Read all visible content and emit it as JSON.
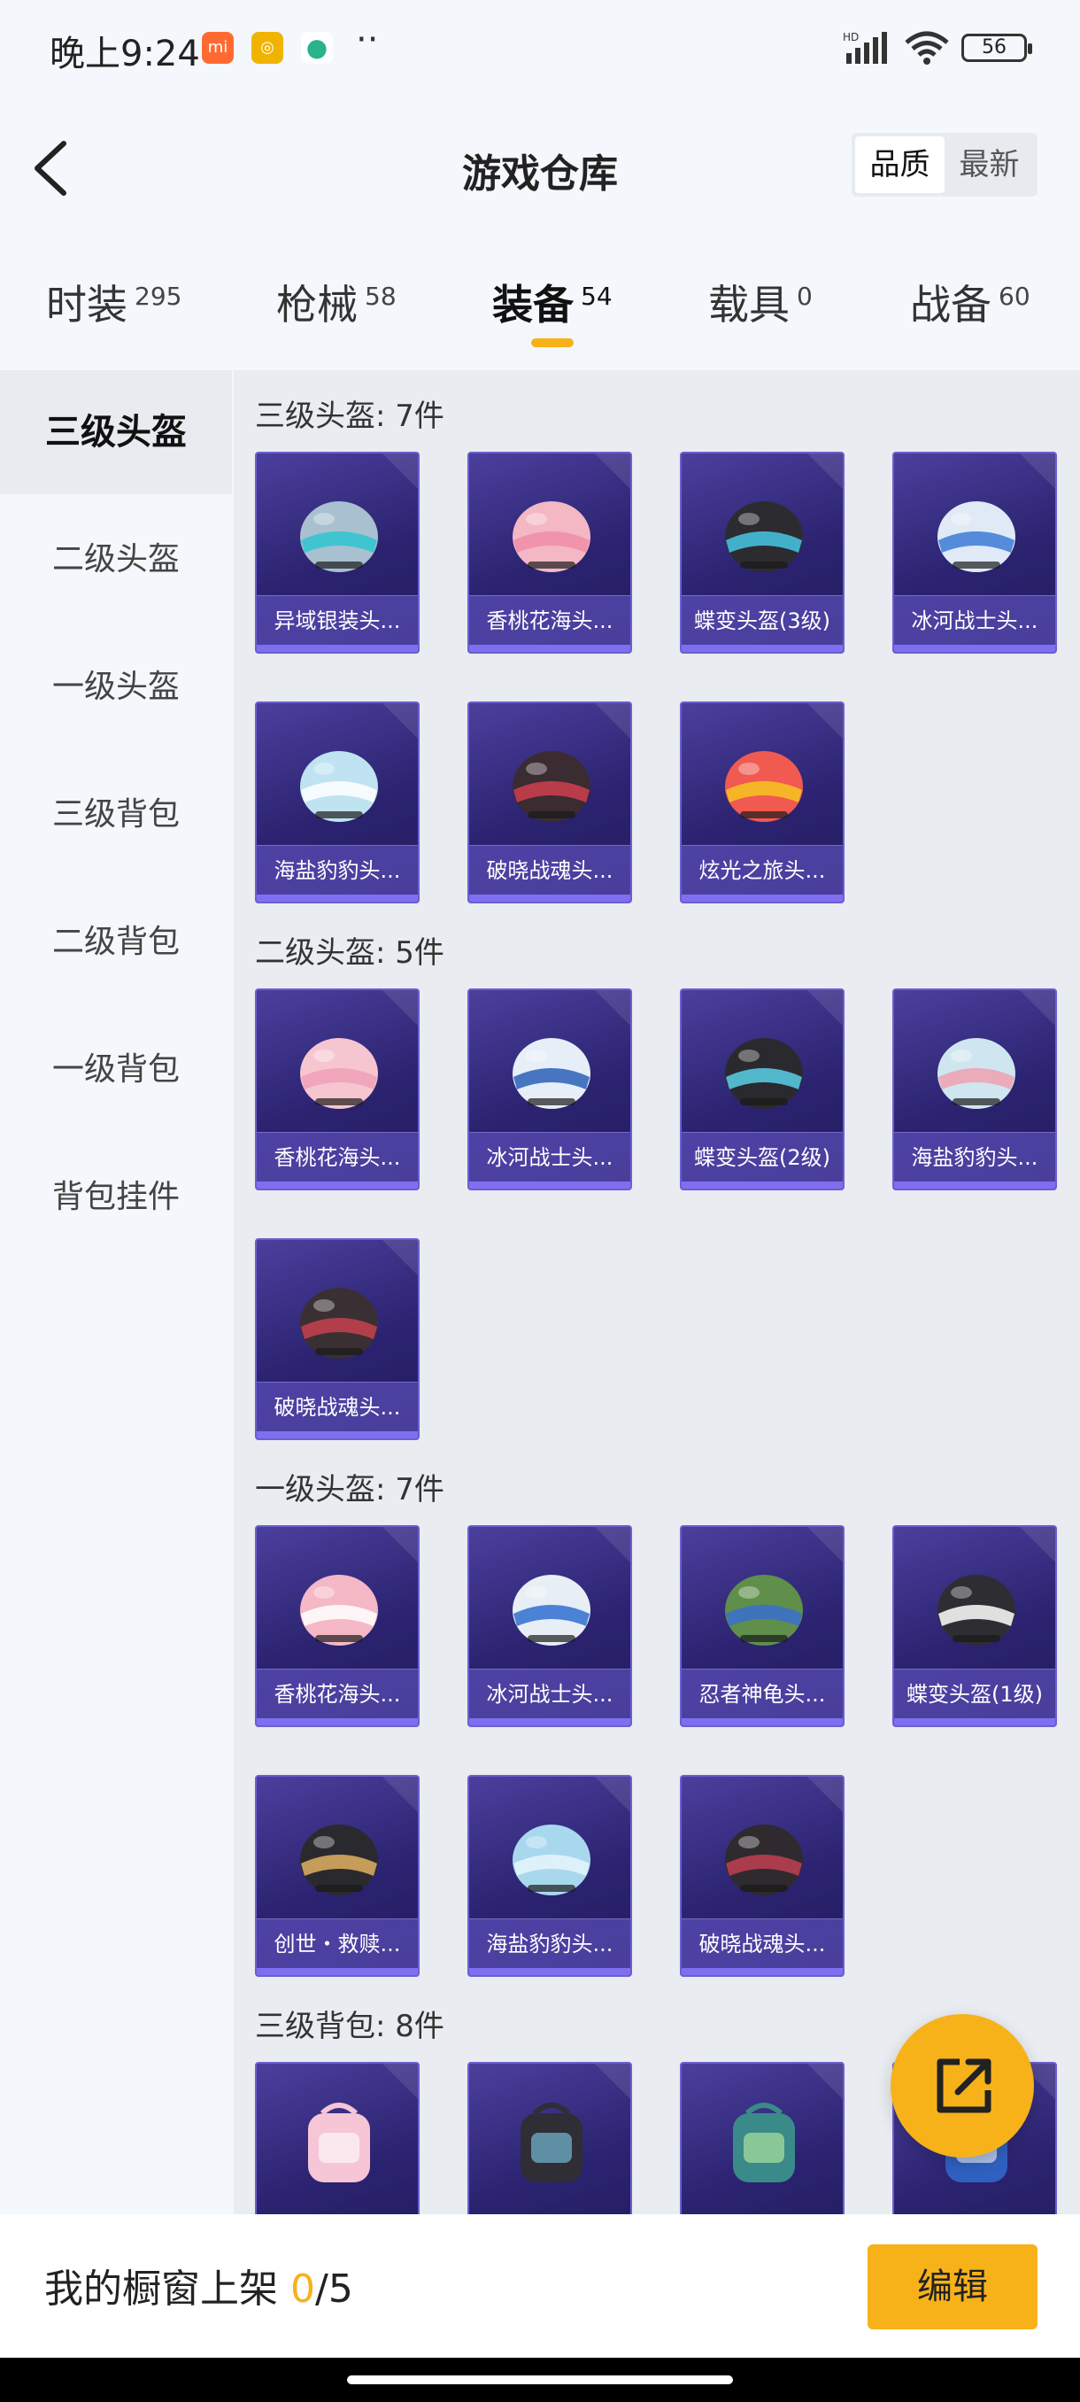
{
  "status": {
    "time": "晚上9:24",
    "apps": [
      {
        "name": "mi-app-icon",
        "color": "#ff6a33",
        "glyph": "mi"
      },
      {
        "name": "gear-app-icon",
        "color": "#f0b400",
        "glyph": "◎"
      },
      {
        "name": "leaf-app-icon",
        "color": "#28b38a",
        "glyph": "●"
      }
    ],
    "dots": "··",
    "hd": "HD",
    "battery": "56"
  },
  "header": {
    "title": "游戏仓库",
    "sort_options": [
      "品质",
      "最新"
    ],
    "sort_active": 0
  },
  "tabs": [
    {
      "label": "时装",
      "count": "295"
    },
    {
      "label": "枪械",
      "count": "58"
    },
    {
      "label": "装备",
      "count": "54",
      "active": true
    },
    {
      "label": "载具",
      "count": "0"
    },
    {
      "label": "战备",
      "count": "60"
    }
  ],
  "sidebar": {
    "items": [
      "三级头盔",
      "二级头盔",
      "一级头盔",
      "三级背包",
      "二级背包",
      "一级背包",
      "背包挂件"
    ],
    "active": 0
  },
  "sections": [
    {
      "title": "三级头盔: 7件",
      "items": [
        {
          "label": "异域银装头...",
          "color": "#a8c0d0",
          "accent": "#2ec5d0"
        },
        {
          "label": "香桃花海头...",
          "color": "#f4b7c4",
          "accent": "#f08da8"
        },
        {
          "label": "蝶变头盔(3级)",
          "color": "#2c2c30",
          "accent": "#47c8e6"
        },
        {
          "label": "冰河战士头...",
          "color": "#dfeaf6",
          "accent": "#3c7bd6"
        },
        {
          "label": "海盐豹豹头...",
          "color": "#bfe3f0",
          "accent": "#ffffff"
        },
        {
          "label": "破晓战魂头...",
          "color": "#3a2c30",
          "accent": "#d04050"
        },
        {
          "label": "炫光之旅头...",
          "color": "#f05a50",
          "accent": "#f7c520"
        }
      ]
    },
    {
      "title": "二级头盔: 5件",
      "items": [
        {
          "label": "香桃花海头...",
          "color": "#f6c6d0",
          "accent": "#f0a0b8"
        },
        {
          "label": "冰河战士头...",
          "color": "#e6eef8",
          "accent": "#2a5fb8"
        },
        {
          "label": "蝶变头盔(2级)",
          "color": "#2a2a2e",
          "accent": "#5ad0e8"
        },
        {
          "label": "海盐豹豹头...",
          "color": "#cfe6f0",
          "accent": "#f0a0b0"
        },
        {
          "label": "破晓战魂头...",
          "color": "#3a3034",
          "accent": "#c84050"
        }
      ]
    },
    {
      "title": "一级头盔: 7件",
      "items": [
        {
          "label": "香桃花海头...",
          "color": "#f4b8c6",
          "accent": "#ffffff"
        },
        {
          "label": "冰河战士头...",
          "color": "#e8eef6",
          "accent": "#2f6fd0"
        },
        {
          "label": "忍者神龟头...",
          "color": "#5f8f4a",
          "accent": "#3a6fd0"
        },
        {
          "label": "蝶变头盔(1级)",
          "color": "#2e2e32",
          "accent": "#ffffff"
        },
        {
          "label": "创世・救赎...",
          "color": "#2a2a2e",
          "accent": "#e0b060"
        },
        {
          "label": "海盐豹豹头...",
          "color": "#a8d8ee",
          "accent": "#e8f4fa"
        },
        {
          "label": "破晓战魂头...",
          "color": "#2e2a2e",
          "accent": "#c04050"
        }
      ]
    },
    {
      "title": "三级背包: 8件",
      "items": [
        {
          "label": "",
          "color": "#f6c6d6",
          "accent": "#ffffff"
        },
        {
          "label": "",
          "color": "#2e2e34",
          "accent": "#7fd0f0"
        },
        {
          "label": "",
          "color": "#3a8a8a",
          "accent": "#c0f0a0"
        },
        {
          "label": "",
          "color": "#3060c0",
          "accent": "#ffffff"
        }
      ]
    }
  ],
  "bottom": {
    "shelf_label": "我的橱窗上架",
    "shelf_count": "0",
    "shelf_total": "/5",
    "edit_label": "编辑"
  },
  "colors": {
    "accent": "#f7b21a",
    "card_bg": "#2b2370",
    "card_border": "#6a5fd0"
  }
}
